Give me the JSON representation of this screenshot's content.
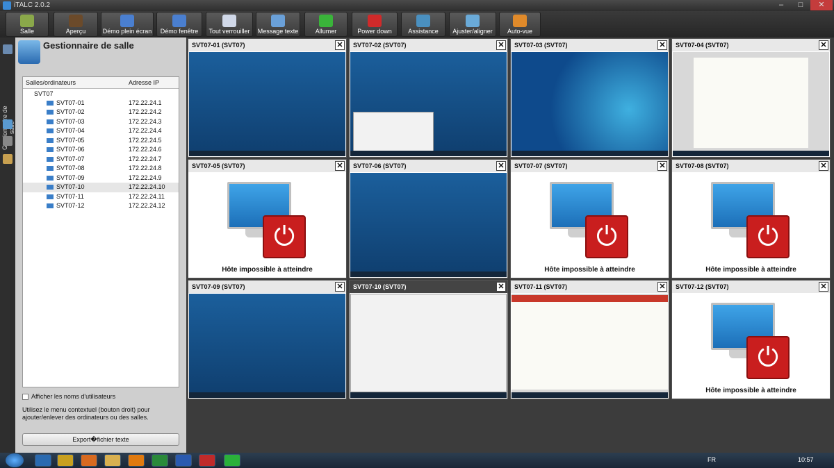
{
  "window": {
    "title": "iTALC 2.0.2",
    "minimize": "–",
    "maximize": "□",
    "close": "✕"
  },
  "toolbar": [
    {
      "label": "Salle",
      "icon": "classroom-icon",
      "color": "#8aa84a"
    },
    {
      "label": "Aperçu",
      "icon": "overview-icon",
      "color": "#6b4a2a"
    },
    {
      "label": "Démo plein écran",
      "icon": "fullscreen-demo-icon",
      "color": "#4a7fd0"
    },
    {
      "label": "Démo fenêtre",
      "icon": "window-demo-icon",
      "color": "#4a7fd0"
    },
    {
      "label": "Tout verrouiller",
      "icon": "lock-icon",
      "color": "#d0d8e8"
    },
    {
      "label": "Message texte",
      "icon": "message-icon",
      "color": "#6aa0d8"
    },
    {
      "label": "Allumer",
      "icon": "power-on-icon",
      "color": "#3ab43a"
    },
    {
      "label": "Power down",
      "icon": "power-down-icon",
      "color": "#d02a2a"
    },
    {
      "label": "Assistance",
      "icon": "assistance-icon",
      "color": "#4a90c0"
    },
    {
      "label": "Ajuster/aligner",
      "icon": "magnifier-icon",
      "color": "#6aaad8"
    },
    {
      "label": "Auto-vue",
      "icon": "autoview-icon",
      "color": "#e08a2a"
    }
  ],
  "sidebar": {
    "tab_label": "Gestionnaire de salle"
  },
  "panel": {
    "title": "Gestionnaire de salle",
    "columns": [
      "Salles/ordinateurs",
      "Adresse IP"
    ],
    "group": "SVT07",
    "computers": [
      {
        "name": "SVT07-01",
        "ip": "172.22.24.1"
      },
      {
        "name": "SVT07-02",
        "ip": "172.22.24.2"
      },
      {
        "name": "SVT07-03",
        "ip": "172.22.24.3"
      },
      {
        "name": "SVT07-04",
        "ip": "172.22.24.4"
      },
      {
        "name": "SVT07-05",
        "ip": "172.22.24.5"
      },
      {
        "name": "SVT07-06",
        "ip": "172.22.24.6"
      },
      {
        "name": "SVT07-07",
        "ip": "172.22.24.7"
      },
      {
        "name": "SVT07-08",
        "ip": "172.22.24.8"
      },
      {
        "name": "SVT07-09",
        "ip": "172.22.24.9"
      },
      {
        "name": "SVT07-10",
        "ip": "172.22.24.10"
      },
      {
        "name": "SVT07-11",
        "ip": "172.22.24.11"
      },
      {
        "name": "SVT07-12",
        "ip": "172.22.24.12"
      }
    ],
    "selected": "SVT07-10",
    "show_users_label": "Afficher les noms d'utilisateurs",
    "hint": "Utilisez le menu contextuel (bouton droit) pour ajouter/enlever des ordinateurs ou des salles.",
    "export_label": "Export�fichier texte"
  },
  "tiles": [
    {
      "title": "SVT07-01 (SVT07)",
      "state": "desktop"
    },
    {
      "title": "SVT07-02 (SVT07)",
      "state": "desktop-browser"
    },
    {
      "title": "SVT07-03 (SVT07)",
      "state": "win7-boot"
    },
    {
      "title": "SVT07-04 (SVT07)",
      "state": "document"
    },
    {
      "title": "SVT07-05 (SVT07)",
      "state": "offline"
    },
    {
      "title": "SVT07-06 (SVT07)",
      "state": "desktop"
    },
    {
      "title": "SVT07-07 (SVT07)",
      "state": "offline"
    },
    {
      "title": "SVT07-08 (SVT07)",
      "state": "offline"
    },
    {
      "title": "SVT07-09 (SVT07)",
      "state": "desktop"
    },
    {
      "title": "SVT07-10 (SVT07)",
      "state": "google-login",
      "selected": true
    },
    {
      "title": "SVT07-11 (SVT07)",
      "state": "document2"
    },
    {
      "title": "SVT07-12 (SVT07)",
      "state": "offline"
    }
  ],
  "offline_message": "Hôte impossible à atteindre",
  "close_glyph": "✕",
  "power_glyph": "⏻",
  "taskbar": {
    "language": "FR",
    "clock": "10:57"
  }
}
